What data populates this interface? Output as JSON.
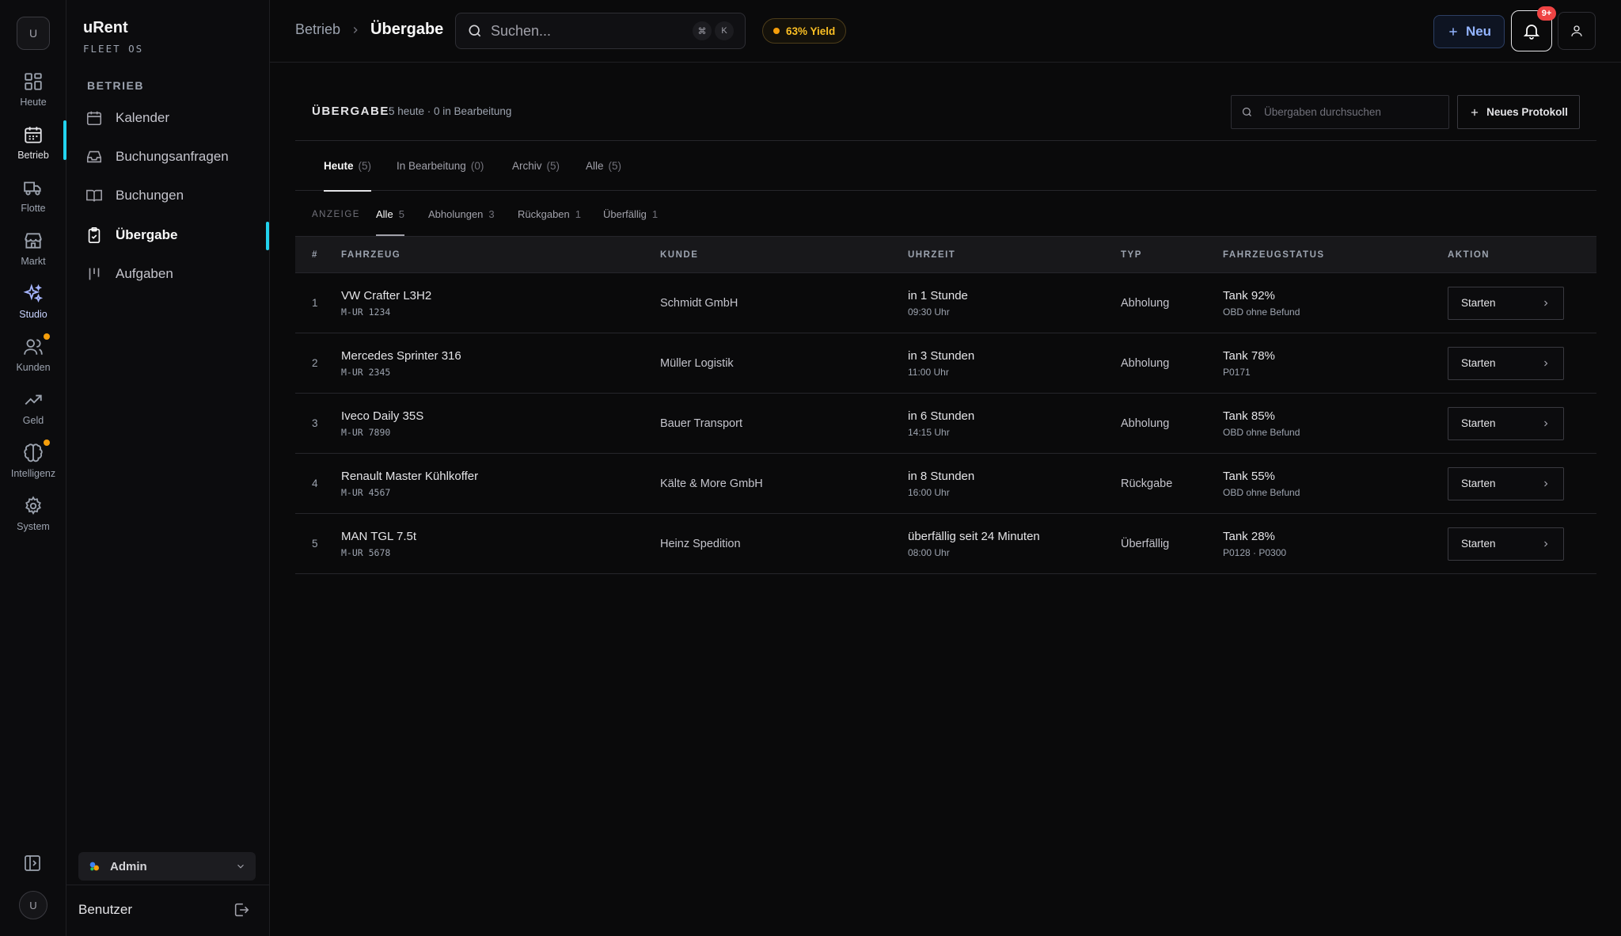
{
  "rail": {
    "avatar": "U",
    "items": [
      {
        "label": "Heute",
        "icon": "grid-icon"
      },
      {
        "label": "Betrieb",
        "icon": "calendar-icon"
      },
      {
        "label": "Flotte",
        "icon": "truck-icon"
      },
      {
        "label": "Markt",
        "icon": "store-icon"
      },
      {
        "label": "Studio",
        "icon": "sparkles-icon"
      },
      {
        "label": "Kunden",
        "icon": "users-icon"
      },
      {
        "label": "Geld",
        "icon": "trending-up-icon"
      },
      {
        "label": "Intelligenz",
        "icon": "brain-icon"
      },
      {
        "label": "System",
        "icon": "gear-icon"
      }
    ],
    "bottom_avatar": "U"
  },
  "sidebar": {
    "brand": "uRent",
    "brand_sub": "FLEET OS",
    "section": "BETRIEB",
    "items": [
      {
        "label": "Kalender",
        "icon": "calendar-icon"
      },
      {
        "label": "Buchungsanfragen",
        "icon": "inbox-icon"
      },
      {
        "label": "Buchungen",
        "icon": "book-open-icon"
      },
      {
        "label": "Übergabe",
        "icon": "clipboard-check-icon"
      },
      {
        "label": "Aufgaben",
        "icon": "kanban-icon"
      }
    ],
    "role": "Admin",
    "user": "Benutzer"
  },
  "topbar": {
    "breadcrumb_parent": "Betrieb",
    "breadcrumb_current": "Übergabe",
    "search_placeholder": "Suchen...",
    "shortcut_1": "⌘",
    "shortcut_2": "K",
    "yield": "63% Yield",
    "new_label": "Neu",
    "notifications": "9+"
  },
  "colors": {
    "accent": "#22d3ee",
    "yield": "#f59e0b",
    "badge": "#ef4444",
    "primary_button": "#93b4ff"
  },
  "page": {
    "title": "ÜBERGABE",
    "meta": "5 heute · 0 in Bearbeitung",
    "search_placeholder": "Übergaben durchsuchen",
    "new_protocol": "Neues Protokoll",
    "tabs": [
      {
        "label": "Heute",
        "count": "(5)"
      },
      {
        "label": "In Bearbeitung",
        "count": "(0)"
      },
      {
        "label": "Archiv",
        "count": "(5)"
      },
      {
        "label": "Alle",
        "count": "(5)"
      }
    ],
    "subfilter_label": "ANZEIGE",
    "subfilters": [
      {
        "label": "Alle",
        "count": "5"
      },
      {
        "label": "Abholungen",
        "count": "3"
      },
      {
        "label": "Rückgaben",
        "count": "1"
      },
      {
        "label": "Überfällig",
        "count": "1"
      }
    ]
  },
  "table": {
    "columns": [
      "#",
      "FAHRZEUG",
      "KUNDE",
      "UHRZEIT",
      "TYP",
      "FAHRZEUGSTATUS",
      "AKTION"
    ],
    "action_label": "Starten",
    "rows": [
      {
        "num": "1",
        "vehicle": "VW Crafter L3H2",
        "plate": "M-UR 1234",
        "customer": "Schmidt GmbH",
        "time": "in 1 Stunde",
        "clock": "09:30 Uhr",
        "type": "Abholung",
        "status": "Tank 92%",
        "status_sub": "OBD ohne Befund"
      },
      {
        "num": "2",
        "vehicle": "Mercedes Sprinter 316",
        "plate": "M-UR 2345",
        "customer": "Müller Logistik",
        "time": "in 3 Stunden",
        "clock": "11:00 Uhr",
        "type": "Abholung",
        "status": "Tank 78%",
        "status_sub": "P0171"
      },
      {
        "num": "3",
        "vehicle": "Iveco Daily 35S",
        "plate": "M-UR 7890",
        "customer": "Bauer Transport",
        "time": "in 6 Stunden",
        "clock": "14:15 Uhr",
        "type": "Abholung",
        "status": "Tank 85%",
        "status_sub": "OBD ohne Befund"
      },
      {
        "num": "4",
        "vehicle": "Renault Master Kühlkoffer",
        "plate": "M-UR 4567",
        "customer": "Kälte & More GmbH",
        "time": "in 8 Stunden",
        "clock": "16:00 Uhr",
        "type": "Rückgabe",
        "status": "Tank 55%",
        "status_sub": "OBD ohne Befund"
      },
      {
        "num": "5",
        "vehicle": "MAN TGL 7.5t",
        "plate": "M-UR 5678",
        "customer": "Heinz Spedition",
        "time": "überfällig seit 24 Minuten",
        "clock": "08:00 Uhr",
        "type": "Überfällig",
        "status": "Tank 28%",
        "status_sub": "P0128 · P0300"
      }
    ]
  }
}
